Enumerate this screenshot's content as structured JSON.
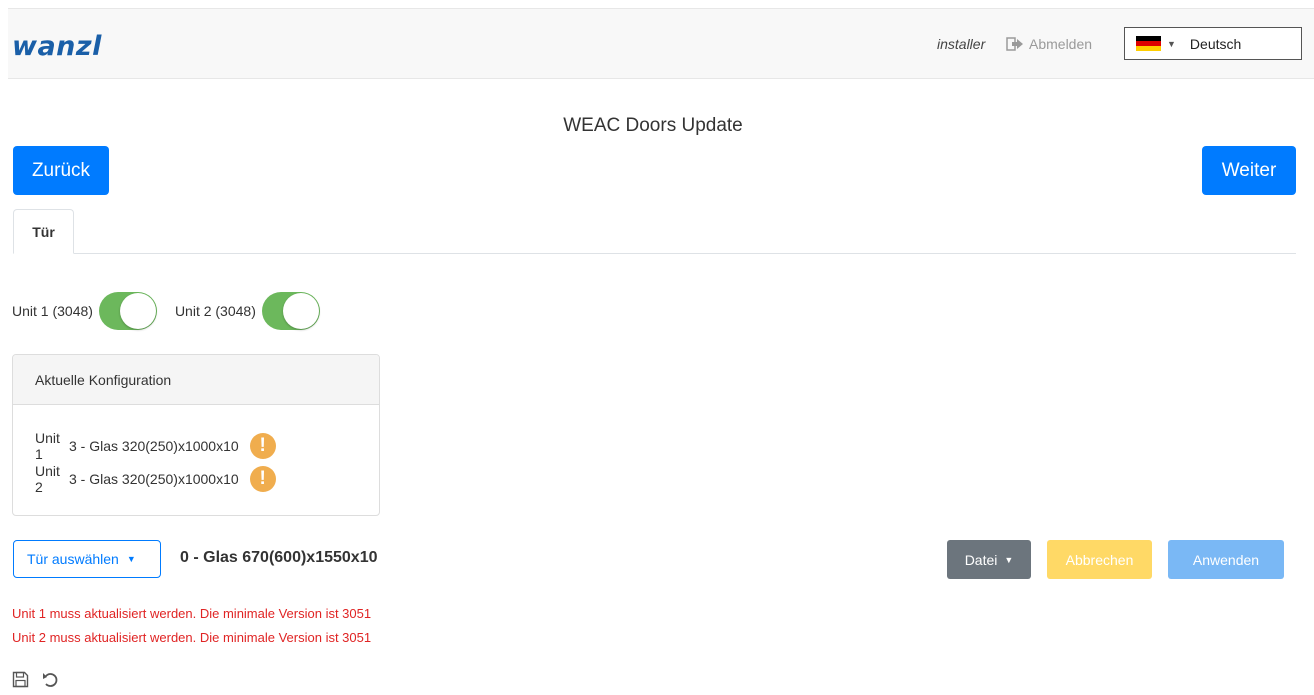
{
  "header": {
    "logo": "wanzl",
    "user": "installer",
    "logout_label": "Abmelden",
    "language": "Deutsch"
  },
  "page": {
    "title": "WEAC Doors Update",
    "back_label": "Zurück",
    "next_label": "Weiter"
  },
  "tabs": [
    {
      "label": "Tür",
      "active": true
    }
  ],
  "toggles": [
    {
      "label": "Unit 1 (3048)",
      "on": true
    },
    {
      "label": "Unit 2 (3048)",
      "on": true
    }
  ],
  "current_config": {
    "title": "Aktuelle Konfiguration",
    "rows": [
      {
        "unit": "Unit 1",
        "config": "3 - Glas 320(250)x1000x10",
        "warning": "!"
      },
      {
        "unit": "Unit 2",
        "config": "3 - Glas 320(250)x1000x10",
        "warning": "!"
      }
    ]
  },
  "door": {
    "select_label": "Tür auswählen",
    "selected": "0 - Glas 670(600)x1550x10"
  },
  "actions": {
    "file_label": "Datei",
    "cancel_label": "Abbrechen",
    "apply_label": "Anwenden"
  },
  "errors": [
    "Unit 1 muss aktualisiert werden. Die minimale Version ist 3051",
    "Unit 2 muss aktualisiert werden. Die minimale Version ist 3051"
  ],
  "colors": {
    "primary": "#007bff",
    "toggle_on": "#6cb85c",
    "warning": "#f0ad4e",
    "error": "#e02424",
    "logo": "#1a5fa8"
  },
  "icons": [
    "logout-icon",
    "germany-flag-icon",
    "save-icon",
    "undo-icon",
    "warning-icon"
  ]
}
